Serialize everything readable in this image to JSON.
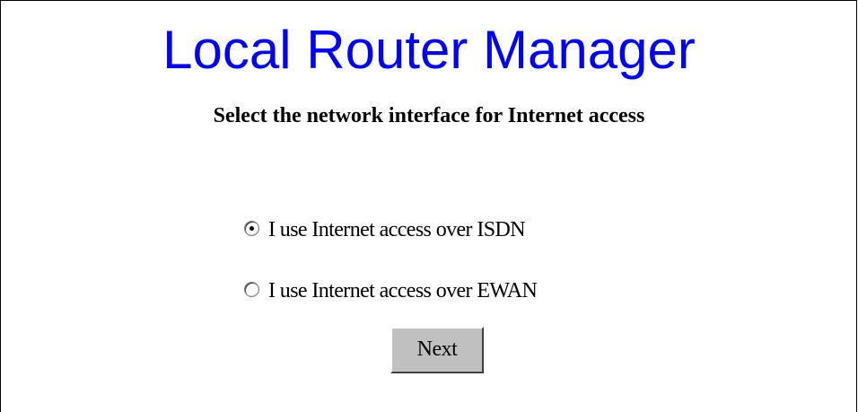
{
  "header": {
    "title": "Local Router Manager",
    "subtitle": "Select the network interface for Internet access"
  },
  "options": [
    {
      "label": "I use Internet access over ISDN",
      "selected": true
    },
    {
      "label": "I use Internet access over EWAN",
      "selected": false
    }
  ],
  "buttons": {
    "next_label": "Next"
  },
  "colors": {
    "title": "#0000ff",
    "button_face": "#c0c0c0",
    "background": "#ffffff"
  }
}
